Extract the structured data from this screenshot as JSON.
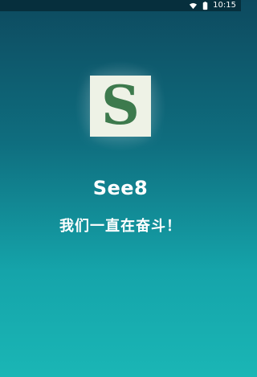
{
  "status_bar": {
    "time": "10:15"
  },
  "splash": {
    "app_name": "See8",
    "tagline": "我们一直在奋斗！",
    "logo_letter": "S"
  },
  "icons": {
    "wifi": "wifi-icon",
    "battery": "battery-icon",
    "logo": "see8-logo-icon"
  },
  "colors": {
    "top_background": "#0d4a5f",
    "bottom_background": "#1ab6b5",
    "logo_background": "#eef2e6",
    "logo_letter": "#3d7a4d",
    "text": "#ffffff"
  }
}
